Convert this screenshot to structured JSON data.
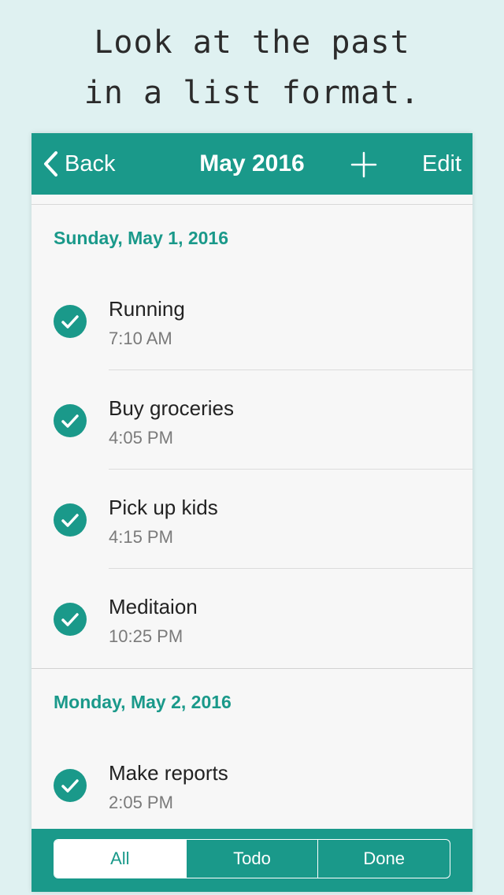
{
  "promo": {
    "line1": "Look at the past",
    "line2": "in a list format."
  },
  "navbar": {
    "back_label": "Back",
    "title": "May 2016",
    "add_icon": "plus-icon",
    "edit_label": "Edit"
  },
  "sections": [
    {
      "header": "Sunday, May 1, 2016",
      "items": [
        {
          "title": "Running",
          "time": "7:10 AM",
          "done": true
        },
        {
          "title": "Buy groceries",
          "time": "4:05 PM",
          "done": true
        },
        {
          "title": "Pick up kids",
          "time": "4:15 PM",
          "done": true
        },
        {
          "title": "Meditaion",
          "time": "10:25 PM",
          "done": true
        }
      ]
    },
    {
      "header": "Monday, May 2, 2016",
      "items": [
        {
          "title": "Make reports",
          "time": "2:05 PM",
          "done": true
        }
      ]
    }
  ],
  "filter": {
    "options": [
      "All",
      "Todo",
      "Done"
    ],
    "selected": "All"
  },
  "colors": {
    "accent": "#1a998a",
    "background": "#dff1f1"
  }
}
